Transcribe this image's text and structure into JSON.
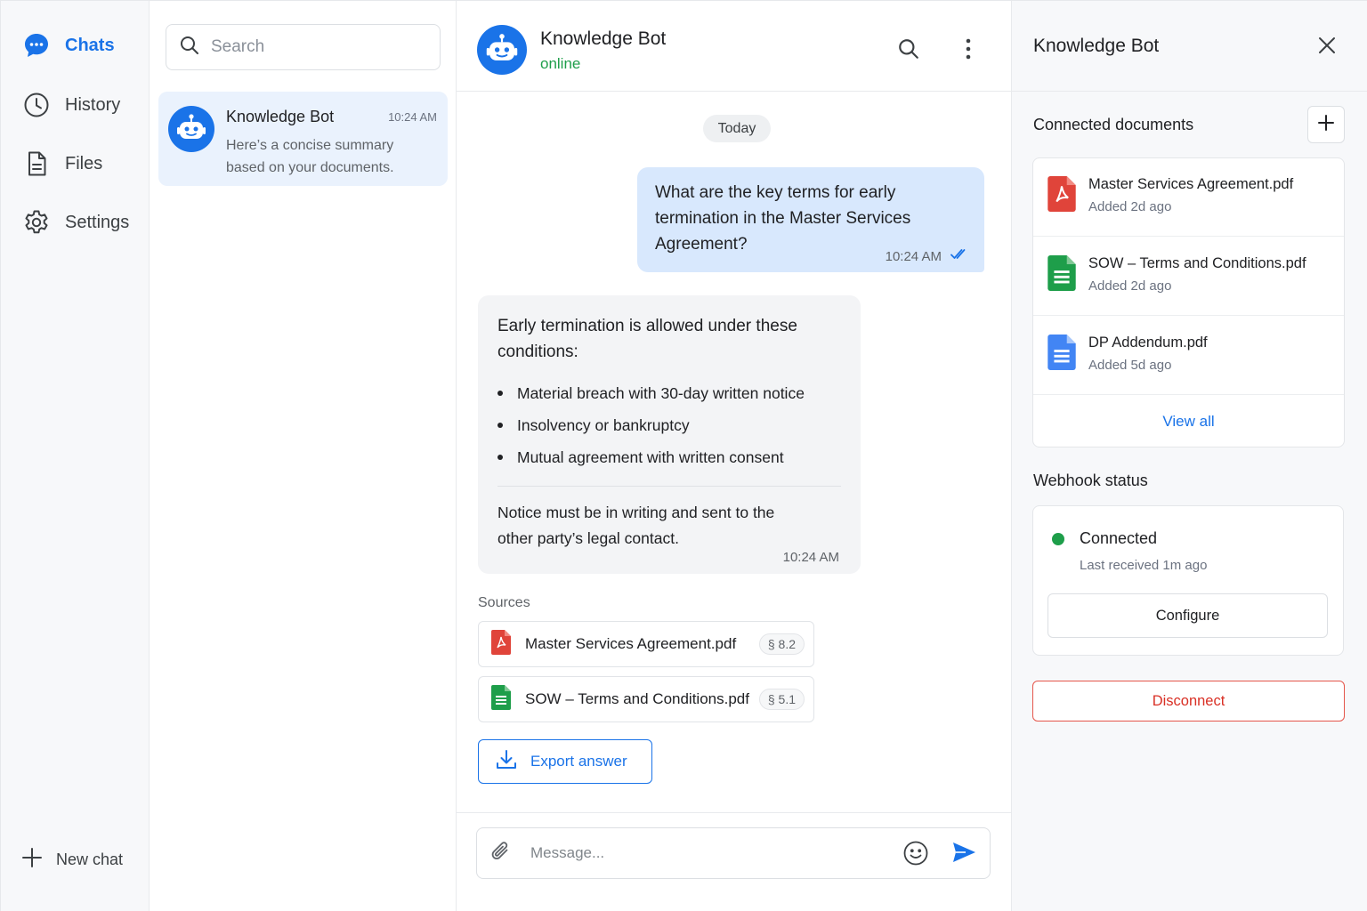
{
  "nav": {
    "items": [
      {
        "label": "Chats",
        "icon": "chat-bubble-icon"
      },
      {
        "label": "History",
        "icon": "clock-icon"
      },
      {
        "label": "Files",
        "icon": "file-icon"
      },
      {
        "label": "Settings",
        "icon": "gear-icon"
      }
    ],
    "new_chat": "New chat",
    "active": "Chats"
  },
  "chat_list": {
    "search_placeholder": "Search",
    "chats": [
      {
        "name": "Knowledge Bot",
        "time": "10:24 AM",
        "preview": "Here’s a concise summary based on your documents."
      }
    ]
  },
  "conversation": {
    "title": "Knowledge Bot",
    "status": "online",
    "day_label": "Today",
    "user_message": {
      "text": "What are the key terms for early termination in the Master Services Agreement?",
      "time": "10:24 AM"
    },
    "bot_message": {
      "intro": "Early termination is allowed under these conditions:",
      "bullets": [
        "Material breach with 30-day written notice",
        "Insolvency or bankruptcy",
        "Mutual agreement with written consent"
      ],
      "note": "Notice must be in writing and sent to the other party’s legal contact.",
      "time": "10:24 AM"
    },
    "sources_label": "Sources",
    "sources": [
      {
        "name": "Master Services Agreement.pdf",
        "section": "§ 8.2",
        "type": "pdf"
      },
      {
        "name": "SOW – Terms and Conditions.pdf",
        "section": "§ 5.1",
        "type": "sheet"
      }
    ],
    "export_label": "Export answer",
    "composer_placeholder": "Message..."
  },
  "side_panel": {
    "title": "Knowledge Bot",
    "docs_title": "Connected documents",
    "documents": [
      {
        "name": "Master Services Agreement.pdf",
        "added": "Added 2d ago",
        "type": "pdf"
      },
      {
        "name": "SOW – Terms and Conditions.pdf",
        "added": "Added 2d ago",
        "type": "sheet"
      },
      {
        "name": "DP Addendum.pdf",
        "added": "Added 5d ago",
        "type": "doc"
      }
    ],
    "view_all": "View all",
    "webhook_title": "Webhook status",
    "webhook_state": "Connected",
    "webhook_last": "Last received 1m ago",
    "configure_label": "Configure",
    "disconnect_label": "Disconnect"
  },
  "colors": {
    "accent": "#1a73e8",
    "online": "#1e9e4a",
    "danger": "#d93025",
    "pdf": "#e0443a",
    "sheet": "#1e9e4a",
    "doc": "#4285f4"
  }
}
